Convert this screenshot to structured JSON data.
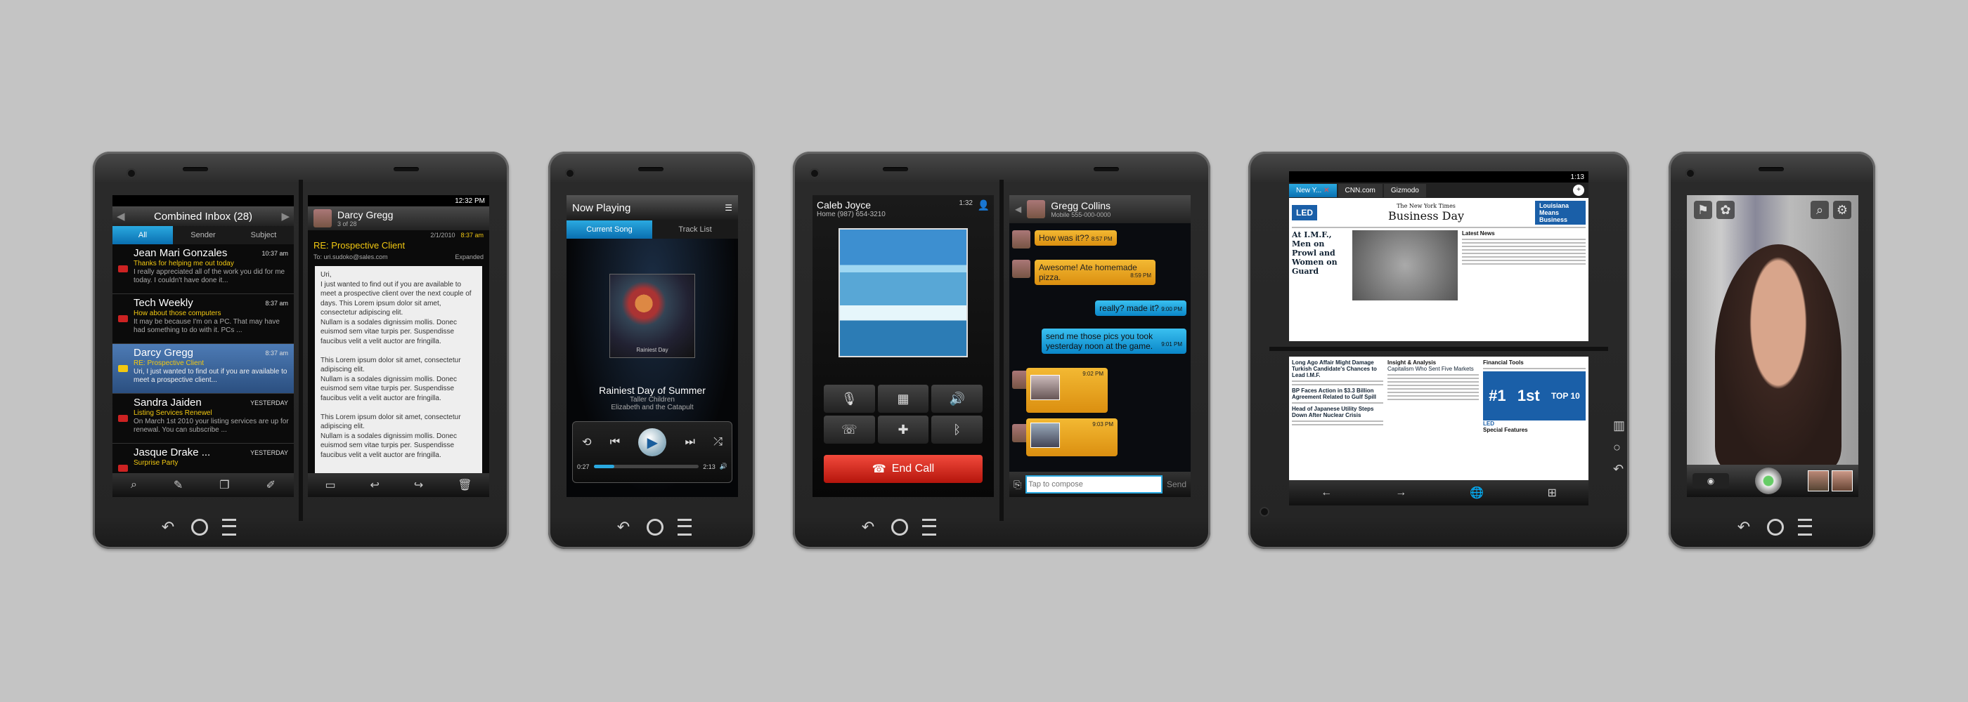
{
  "email_phone": {
    "inbox": {
      "title": "Combined Inbox (28)",
      "tabs": [
        "All",
        "Sender",
        "Subject"
      ],
      "messages": [
        {
          "sender": "Jean Mari Gonzales",
          "time": "10:37 am",
          "subject": "Thanks for helping me out today",
          "preview": "I really appreciated all of the work you did for me today. I couldn't have done it..."
        },
        {
          "sender": "Tech Weekly",
          "time": "8:37 am",
          "subject": "How about those computers",
          "preview": "It may be because I'm on a PC. That may have had something to do with it. PCs ..."
        },
        {
          "sender": "Darcy Gregg",
          "time": "8:37 am",
          "subject": "RE: Prospective Client",
          "preview": "Uri, I just wanted to find out if you are available to meet a prospective client..."
        },
        {
          "sender": "Sandra Jaiden",
          "time": "YESTERDAY",
          "subject": "Listing Services Renewel",
          "preview": "On March 1st 2010 your listing services are up for renewal. You can subscribe ..."
        },
        {
          "sender": "Jasque Drake ...",
          "time": "YESTERDAY",
          "subject": "Surprise Party",
          "preview": ""
        }
      ]
    },
    "message": {
      "status_time": "12:32 PM",
      "sender": "Darcy Gregg",
      "position": "3 of 28",
      "date": "2/1/2010",
      "time": "8:37 am",
      "subject": "RE: Prospective Client",
      "to": "To: uri.sudoko@sales.com",
      "expires": "Expanded",
      "body": "Uri,\nI just wanted to find out if you are available to meet a prospective client over the next couple of days. This Lorem ipsum dolor sit amet, consectetur adipiscing elit.\nNullam is a sodales dignissim mollis. Donec euismod sem vitae turpis per. Suspendisse faucibus velit a velit auctor are fringilla.\n\nThis Lorem ipsum dolor sit amet, consectetur adipiscing elit.\nNullam is a sodales dignissim mollis. Donec euismod sem vitae turpis per. Suspendisse faucibus velit a velit auctor are fringilla.\n\nThis Lorem ipsum dolor sit amet, consectetur adipiscing elit.\nNullam is a sodales dignissim mollis. Donec euismod sem vitae turpis per. Suspendisse faucibus velit a velit auctor are fringilla."
    }
  },
  "music_phone": {
    "title": "Now Playing",
    "tabs": [
      "Current Song",
      "Track List"
    ],
    "album_art_text": "Rainiest Day",
    "song": "Rainiest Day of Summer",
    "artist": "Taller Children",
    "album": "Elizabeth and the Catapult",
    "elapsed": "0:27",
    "duration": "2:13",
    "progress": 0.2
  },
  "call_phone": {
    "caller": "Caleb Joyce",
    "number": "Home (987) 654-3210",
    "duration": "1:32",
    "end_call": "End Call"
  },
  "chat_phone": {
    "contact": "Gregg Collins",
    "contact_number": "Mobile 555-000-0000",
    "messages": [
      {
        "from": "them",
        "text": "How was it??",
        "time": "8:57 PM"
      },
      {
        "from": "them",
        "text": "Awesome! Ate homemade pizza.",
        "time": "8:59 PM"
      },
      {
        "from": "me",
        "text": "really? made it?",
        "time": "9:00 PM"
      },
      {
        "from": "me",
        "text": "send me those pics you took yesterday noon at the game.",
        "time": "9:01 PM"
      },
      {
        "from": "them",
        "text": "",
        "time": "9:02 PM"
      },
      {
        "from": "them",
        "text": "",
        "time": "9:03 PM"
      }
    ],
    "compose_placeholder": "Tap to compose",
    "send": "Send"
  },
  "browser_phone": {
    "time": "1:13",
    "tabs": [
      "New Y...",
      "CNN.com",
      "Gizmodo"
    ],
    "top_page": {
      "masthead": "The New York Times",
      "section": "Business Day",
      "ad_left": "LED",
      "ad_right": "Louisiana Means Business",
      "headline": "At I.M.F., Men on Prowl and Women on Guard",
      "latest": "Latest News"
    },
    "bottom_page": {
      "col1_headline": "Long Ago Affair Might Damage Turkish Candidate's Chances to Lead I.M.F.",
      "col1_headline2": "BP Faces Action in $3.3 Billion Agreement Related to Gulf Spill",
      "col1_headline3": "Head of Japanese Utility Steps Down After Nuclear Crisis",
      "col2_header": "Insight & Analysis",
      "col2_headline": "Capitalism Who Sent Five Markets",
      "ad_big": "#1",
      "ad_1st": "1st",
      "ad_top10": "TOP 10",
      "ad_led": "LED",
      "financial_tools": "Financial Tools",
      "special_features": "Special Features"
    }
  },
  "camera_phone": {}
}
